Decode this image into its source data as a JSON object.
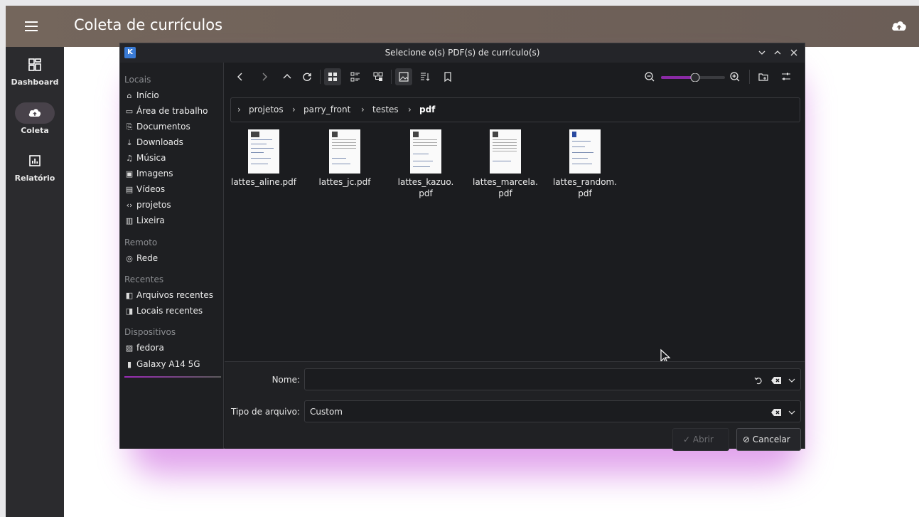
{
  "app": {
    "title": "Coleta de currículos",
    "menu_icon": "hamburger-menu-icon",
    "header_action_icon": "cloud-upload-icon"
  },
  "rail": {
    "items": [
      {
        "label": "Dashboard",
        "icon": "dashboard-icon",
        "active": false
      },
      {
        "label": "Coleta",
        "icon": "cloud-upload-icon",
        "active": true
      },
      {
        "label": "Relatório",
        "icon": "report-icon",
        "active": false
      }
    ]
  },
  "dialog": {
    "title": "Selecione o(s) PDF(s) de currículo(s)",
    "places": {
      "sections": {
        "locais": "Locais",
        "remoto": "Remoto",
        "recentes": "Recentes",
        "dispositivos": "Dispositivos"
      },
      "locais": [
        "Início",
        "Área de trabalho",
        "Documentos",
        "Downloads",
        "Música",
        "Imagens",
        "Vídeos",
        "projetos",
        "Lixeira"
      ],
      "remoto": [
        "Rede"
      ],
      "recentes": [
        "Arquivos recentes",
        "Locais recentes"
      ],
      "dispositivos": [
        "fedora",
        "Galaxy A14 5G"
      ]
    },
    "breadcrumb": [
      "projetos",
      "parry_front",
      "testes",
      "pdf"
    ],
    "files": [
      {
        "name_line1": "lattes_aline.pdf",
        "name_line2": ""
      },
      {
        "name_line1": "lattes_jc.pdf",
        "name_line2": ""
      },
      {
        "name_line1": "lattes_kazuo.",
        "name_line2": "pdf"
      },
      {
        "name_line1": "lattes_marcela.",
        "name_line2": "pdf"
      },
      {
        "name_line1": "lattes_random.",
        "name_line2": "pdf"
      }
    ],
    "name_label": "Nome:",
    "name_value": "",
    "filetype_label": "Tipo de arquivo:",
    "filetype_value": "Custom",
    "open_button": "Abrir",
    "cancel_button": "Cancelar"
  },
  "colors": {
    "header": "#74665c",
    "rail": "#2b2b2e",
    "dialog_bg": "#1b1c1f",
    "accent": "#9c2bb8",
    "glow": "#c85adc"
  }
}
